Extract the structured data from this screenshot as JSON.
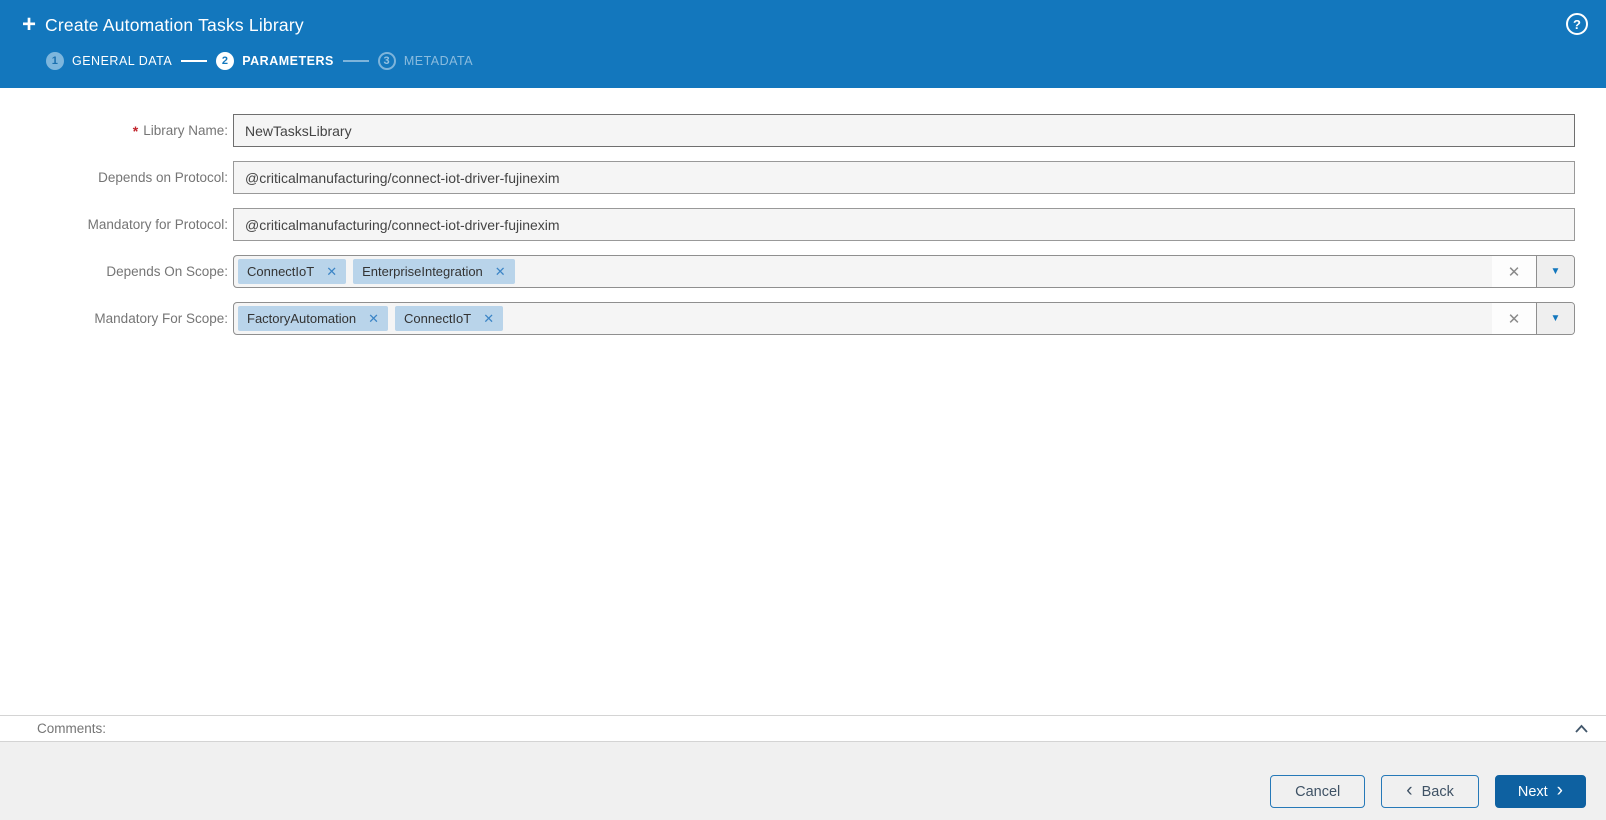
{
  "header": {
    "title": "Create Automation Tasks Library",
    "steps": [
      {
        "number": "1",
        "label": "GENERAL DATA",
        "state": "done"
      },
      {
        "number": "2",
        "label": "PARAMETERS",
        "state": "active"
      },
      {
        "number": "3",
        "label": "METADATA",
        "state": "upcoming"
      }
    ]
  },
  "form": {
    "required_marker": "*",
    "fields": [
      {
        "label": "Library Name:",
        "required": true,
        "type": "text",
        "value": "NewTasksLibrary"
      },
      {
        "label": "Depends on Protocol:",
        "required": false,
        "type": "text",
        "value": "@criticalmanufacturing/connect-iot-driver-fujinexim"
      },
      {
        "label": "Mandatory for Protocol:",
        "required": false,
        "type": "text",
        "value": "@criticalmanufacturing/connect-iot-driver-fujinexim"
      },
      {
        "label": "Depends On Scope:",
        "required": false,
        "type": "multiselect",
        "chips": [
          "ConnectIoT",
          "EnterpriseIntegration"
        ]
      },
      {
        "label": "Mandatory For Scope:",
        "required": false,
        "type": "multiselect",
        "chips": [
          "FactoryAutomation",
          "ConnectIoT"
        ]
      }
    ]
  },
  "comments": {
    "label": "Comments:",
    "collapse_icon": "chevron-up-icon",
    "collapsed": false
  },
  "footer": {
    "cancel_label": "Cancel",
    "back_label": "Back",
    "next_label": "Next"
  },
  "icons": {
    "add": "+",
    "help": "?",
    "chip_remove": "✕",
    "clear_field": "✕",
    "dropdown_arrow": "▼",
    "back_chevron": "‹",
    "next_chevron": "›"
  },
  "colors": {
    "header_bg": "#1377bd",
    "chip_bg": "#b9d4ea",
    "primary_button_bg": "#0e61a1",
    "footer_bg": "#f0f0f0",
    "required_marker": "#c1242b"
  }
}
